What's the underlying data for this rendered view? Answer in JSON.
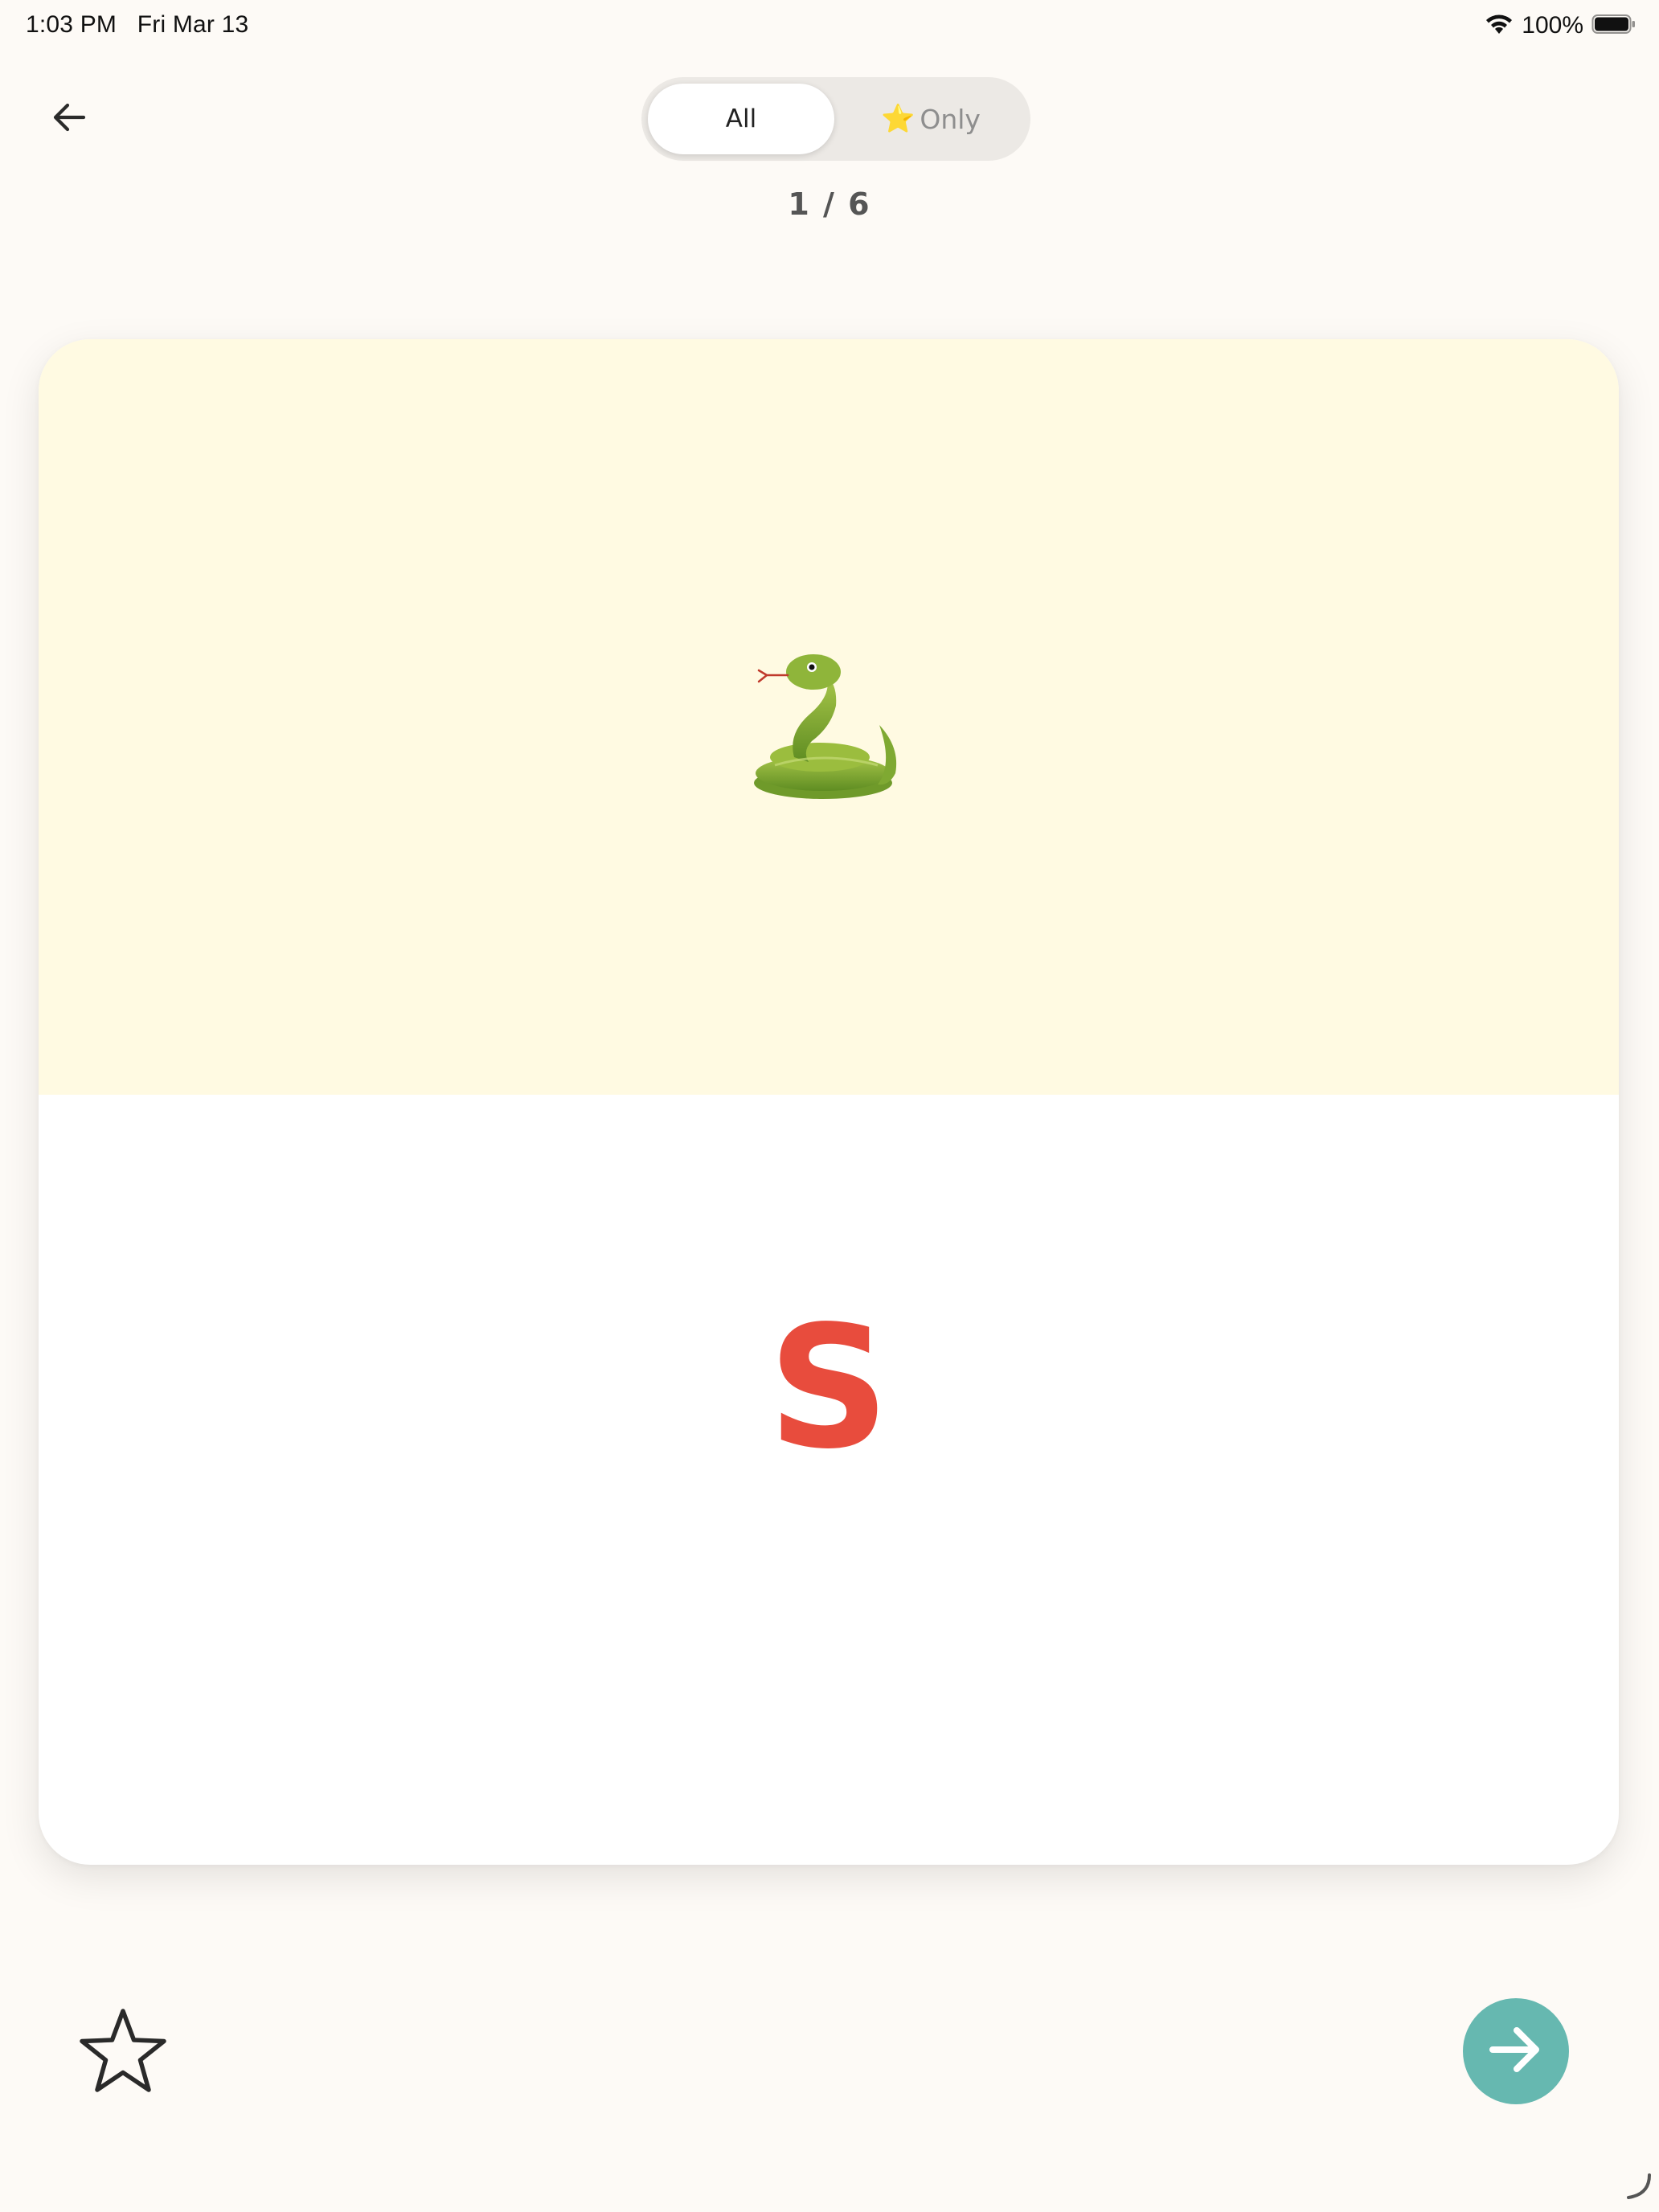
{
  "status_bar": {
    "time_date": "1:03 PM   Fri Mar 13",
    "battery": "100%",
    "icons": [
      "wifi-icon",
      "battery-icon"
    ]
  },
  "header": {
    "back_icon": "arrow-left-icon",
    "filter": {
      "all_label": "All",
      "only_icon": "⭐",
      "only_label": "Only",
      "selected": "All"
    },
    "counter": "1 / 6"
  },
  "card": {
    "illustration": "snake-icon",
    "letter": "S",
    "colors": {
      "top_background": "#fffae2",
      "bottom_background": "#ffffff",
      "letter": "#e84c3d"
    }
  },
  "footer": {
    "favorite_icon": "star-outline-icon",
    "next_icon": "arrow-right-icon",
    "next_color": "#66b8b0"
  }
}
